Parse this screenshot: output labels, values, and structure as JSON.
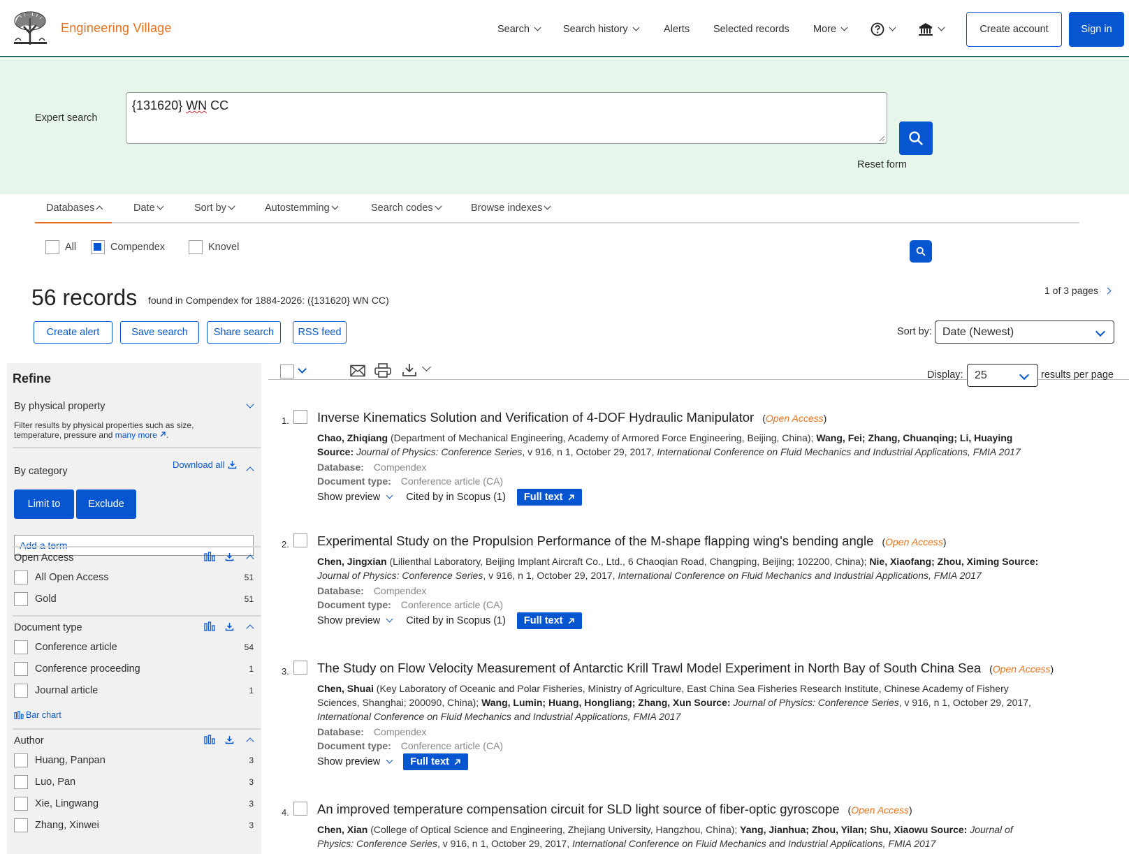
{
  "header": {
    "brand": "Engineering Village",
    "nav": [
      "Search",
      "Search history",
      "Alerts",
      "Selected records",
      "More"
    ],
    "create_account": "Create account",
    "sign_in": "Sign in"
  },
  "search": {
    "label": "Expert search",
    "query_part1": "{131620}",
    "query_part2": "WN",
    "query_part3": "CC",
    "reset": "Reset form"
  },
  "options": [
    "Databases",
    "Date",
    "Sort by",
    "Autostemming",
    "Search codes",
    "Browse indexes"
  ],
  "databases": [
    {
      "label": "All",
      "checked": false
    },
    {
      "label": "Compendex",
      "checked": true
    },
    {
      "label": "Knovel",
      "checked": false
    }
  ],
  "results_header": {
    "count": "56 records",
    "found_text": "found in Compendex for 1884-2026: ({131620} WN CC)",
    "pages": "1 of 3 pages",
    "buttons": [
      "Create alert",
      "Save search",
      "Share search",
      "RSS feed"
    ],
    "sort_label": "Sort by:",
    "sort_value": "Date (Newest)",
    "display_label": "Display:",
    "display_value": "25",
    "per_page": "results per page"
  },
  "refine": {
    "title": "Refine",
    "physical_property": "By physical property",
    "physical_desc_1": "Filter results by physical properties such as size,",
    "physical_desc_2": "temperature, pressure and",
    "physical_link": "many more",
    "by_category": "By category",
    "download_all": "Download all",
    "limit_to": "Limit to",
    "exclude": "Exclude",
    "add_term": "Add a term",
    "open_access": {
      "title": "Open Access",
      "items": [
        {
          "label": "All Open Access",
          "count": "51"
        },
        {
          "label": "Gold",
          "count": "51"
        }
      ]
    },
    "document_type": {
      "title": "Document type",
      "items": [
        {
          "label": "Conference article",
          "count": "54"
        },
        {
          "label": "Conference proceeding",
          "count": "1"
        },
        {
          "label": "Journal article",
          "count": "1"
        }
      ]
    },
    "bar_chart": "Bar chart",
    "author": {
      "title": "Author",
      "items": [
        {
          "label": "Huang, Panpan",
          "count": "3"
        },
        {
          "label": "Luo, Pan",
          "count": "3"
        },
        {
          "label": "Xie, Lingwang",
          "count": "3"
        },
        {
          "label": "Zhang, Xinwei",
          "count": "3"
        }
      ]
    }
  },
  "results": [
    {
      "num": "1.",
      "title": "Inverse Kinematics Solution and Verification of 4-DOF Hydraulic Manipulator",
      "open_access": "Open Access",
      "author1": "Chao, Zhiqiang",
      "affil": "(Department of Mechanical Engineering, Academy of Armored Force Engineering, Beijing, China);",
      "others": "Wang, Fei; Zhang, Chuanqing; Li, Huaying",
      "source_label": "Source:",
      "source": "Journal of Physics: Conference Series",
      "source_detail": ", v 916, n 1, October 29, 2017,",
      "conference": "International Conference on Fluid Mechanics and Industrial Applications, FMIA 2017",
      "database_label": "Database:",
      "database": "Compendex",
      "doctype_label": "Document type:",
      "doctype": "Conference article (CA)",
      "show_preview": "Show preview",
      "cited": "Cited by in Scopus (1)",
      "full_text": "Full text"
    },
    {
      "num": "2.",
      "title": "Experimental Study on the Propulsion Performance of the M-shape flapping wing's bending angle",
      "open_access": "Open Access",
      "author1": "Chen, Jingxian",
      "affil": "(Lilienthal Laboratory, Beijing Implant Aircraft Co., Ltd., 6 Chaoqian Road, Changping, Beijing; 102200, China);",
      "others": "Nie, Xiaofang; Zhou, Ximing",
      "source_label": "Source:",
      "source": "Journal of Physics: Conference Series",
      "source_detail": ", v 916, n 1, October 29, 2017,",
      "conference": "International Conference on Fluid Mechanics and Industrial Applications, FMIA 2017",
      "database_label": "Database:",
      "database": "Compendex",
      "doctype_label": "Document type:",
      "doctype": "Conference article (CA)",
      "show_preview": "Show preview",
      "cited": "Cited by in Scopus (1)",
      "full_text": "Full text"
    },
    {
      "num": "3.",
      "title": "The Study on Flow Velocity Measurement of Antarctic Krill Trawl Model Experiment in North Bay of South China Sea",
      "open_access": "Open Access",
      "author1": "Chen, Shuai",
      "affil_a": "(Key Laboratory of Oceanic and Polar Fisheries, Ministry of Agriculture, East China Sea Fisheries Research Institute, Chinese Academy of Fishery",
      "affil_b": "Sciences, Shanghai; 200090, China);",
      "others": "Wang, Lumin; Huang, Hongliang; Zhang, Xun",
      "source_label": "Source:",
      "source": "Journal of Physics: Conference Series",
      "source_detail": ", v 916, n 1, October 29, 2017,",
      "conference": "International Conference on Fluid Mechanics and Industrial Applications, FMIA 2017",
      "database_label": "Database:",
      "database": "Compendex",
      "doctype_label": "Document type:",
      "doctype": "Conference article (CA)",
      "show_preview": "Show preview",
      "full_text": "Full text"
    },
    {
      "num": "4.",
      "title": "An improved temperature compensation circuit for SLD light source of fiber-optic gyroscope",
      "open_access": "Open Access",
      "author1": "Chen, Xian",
      "affil": "(College of Optical Science and Engineering, Zhejiang University, Hangzhou, China);",
      "others": "Yang, Jianhua; Zhou, Yilan; Shu, Xiaowu",
      "source_label": "Source:",
      "source_a": "Journal of",
      "source_b": "Physics: Conference Series",
      "source_detail": ", v 916, n 1, October 29, 2017,",
      "conference": "International Conference on Fluid Mechanics and Industrial Applications, FMIA 2017"
    }
  ]
}
